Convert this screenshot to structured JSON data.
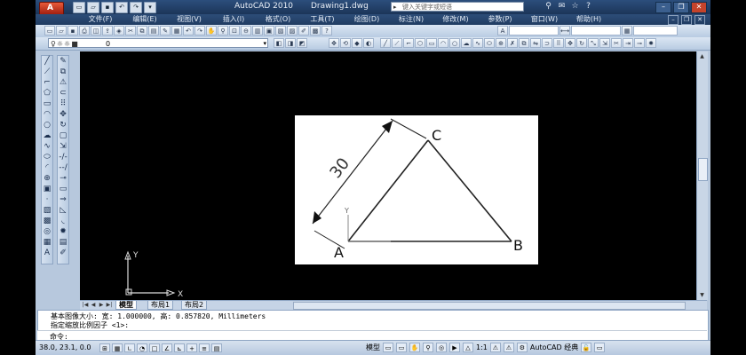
{
  "window": {
    "app_title": "AutoCAD 2010",
    "doc_title": "Drawing1.dwg",
    "search_placeholder": "键入关键字或短语"
  },
  "menu": {
    "items": [
      "文件(F)",
      "编辑(E)",
      "视图(V)",
      "插入(I)",
      "格式(O)",
      "工具(T)",
      "绘图(D)",
      "标注(N)",
      "修改(M)",
      "参数(P)",
      "窗口(W)",
      "帮助(H)"
    ]
  },
  "layer": {
    "current": "0"
  },
  "drawing": {
    "dimension_text": "30",
    "vertex_a": "A",
    "vertex_b": "B",
    "vertex_c": "C",
    "inset_y": "Y",
    "ucs_y": "Y",
    "ucs_x": "X"
  },
  "tabs": {
    "model": "模型",
    "layout1": "布局1",
    "layout2": "布局2"
  },
  "command": {
    "line1": "基本图像大小: 宽: 1.000000, 高: 0.857820, Millimeters",
    "line2": "指定缩放比例因子 <1>:",
    "prompt": "命令:"
  },
  "status": {
    "coords": "38.0, 23.1, 0.0",
    "model_label": "模型",
    "scale": "1:1",
    "workspace": "AutoCAD 经典"
  },
  "colors": {
    "title_bar": "#1c3558",
    "canvas": "#000000",
    "accent_red": "#c4432b"
  }
}
